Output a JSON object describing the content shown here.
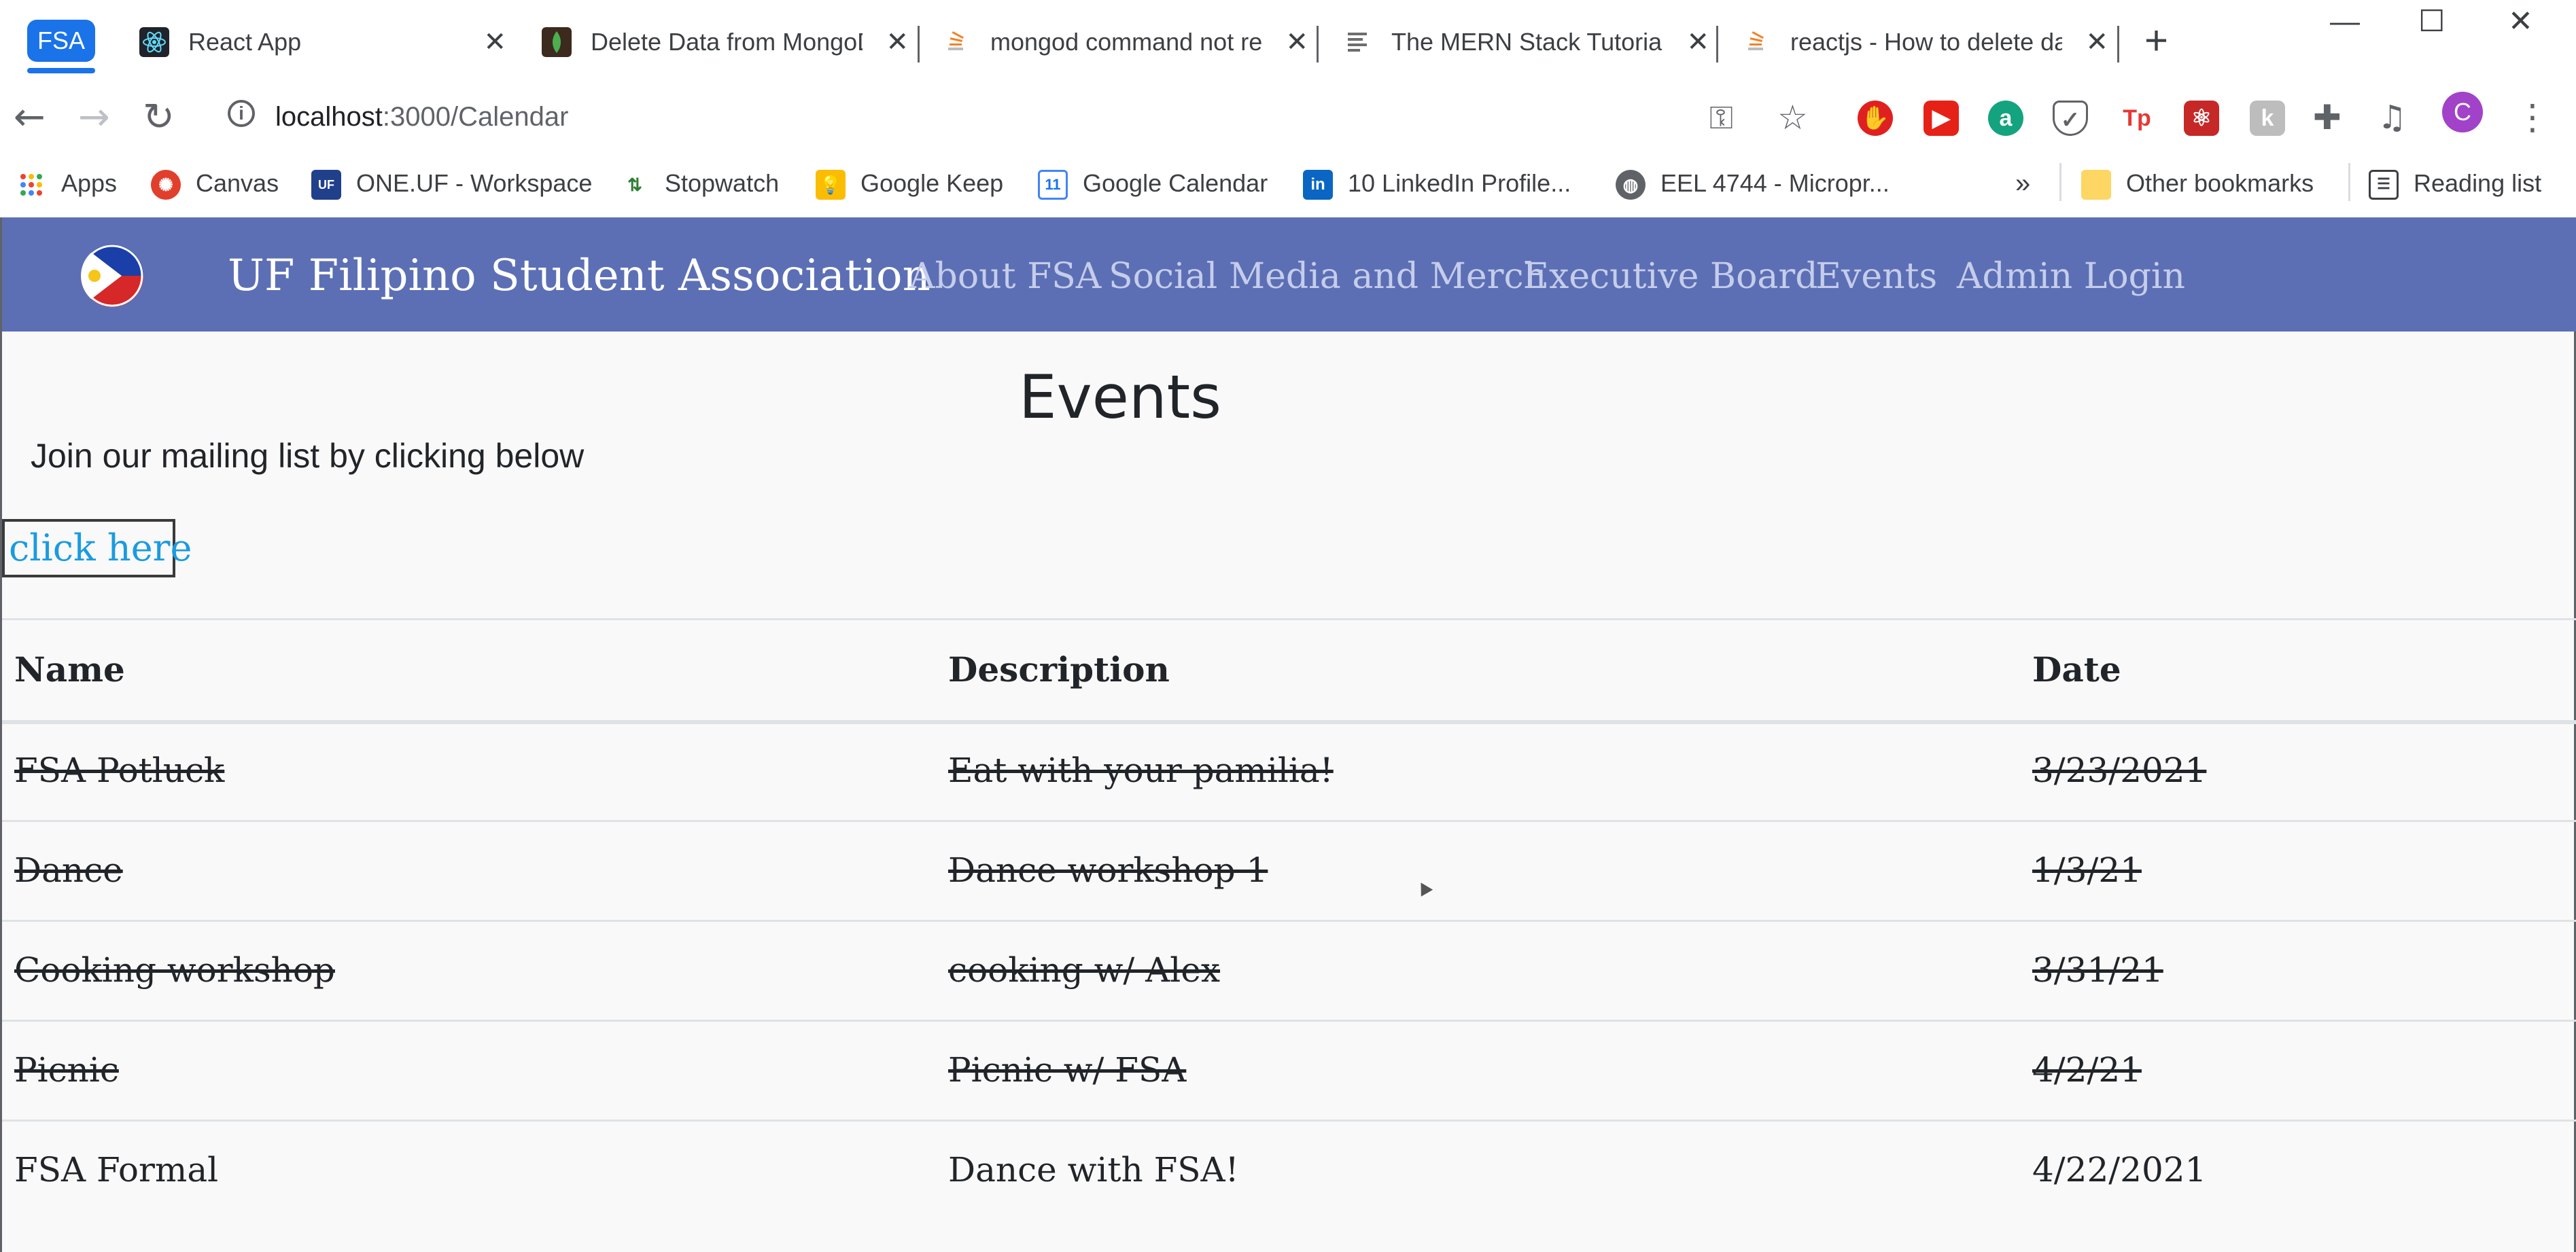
{
  "browser": {
    "tab_group_label": "FSA",
    "tabs": [
      {
        "title": "React App",
        "icon": "react-icon",
        "color": "#61dafb"
      },
      {
        "title": "Delete Data from MongoDB",
        "icon": "mongodb-icon",
        "color": "#4caf50"
      },
      {
        "title": "mongod command not recognized",
        "icon": "stackoverflow-icon",
        "color": "#f48024"
      },
      {
        "title": "The MERN Stack Tutorial",
        "icon": "tutorial-icon",
        "color": "#6d6d6d"
      },
      {
        "title": "reactjs - How to delete data",
        "icon": "stackoverflow-icon",
        "color": "#f48024"
      }
    ],
    "url_host": "localhost",
    "url_path": ":3000/Calendar",
    "bookmarks": [
      {
        "label": "Apps"
      },
      {
        "label": "Canvas"
      },
      {
        "label": "ONE.UF - Workspace"
      },
      {
        "label": "Stopwatch"
      },
      {
        "label": "Google Keep"
      },
      {
        "label": "Google Calendar"
      },
      {
        "label": "10 LinkedIn Profile..."
      },
      {
        "label": "EEL 4744 - Micropr..."
      },
      {
        "label": "Other bookmarks"
      },
      {
        "label": "Reading list"
      }
    ],
    "avatar_letter": "C"
  },
  "site": {
    "brand": "UF Filipino Student Association",
    "nav": [
      "About FSA",
      "Social Media and Merch",
      "Executive Board",
      "Events",
      "Admin Login"
    ],
    "navbar_color": "#5c6fb5"
  },
  "main": {
    "title": "Events",
    "mailing_text": "Join our mailing list by clicking below",
    "button_label": "click here"
  },
  "table": {
    "headers": [
      "Name",
      "Description",
      "Date"
    ],
    "rows": [
      {
        "name": "FSA Potluck",
        "description": "Eat with your pamilia!",
        "date": "3/23/2021",
        "crossed_out": true
      },
      {
        "name": "Dance",
        "description": "Dance workshop 1",
        "date": "1/3/21",
        "crossed_out": true
      },
      {
        "name": "Cooking workshop",
        "description": "cooking w/ Alex",
        "date": "3/31/21",
        "crossed_out": true
      },
      {
        "name": "Picnic",
        "description": "Picnic w/ FSA",
        "date": "4/2/21",
        "crossed_out": true
      },
      {
        "name": "FSA Formal",
        "description": "Dance with FSA!",
        "date": "4/22/2021",
        "crossed_out": false
      }
    ]
  }
}
